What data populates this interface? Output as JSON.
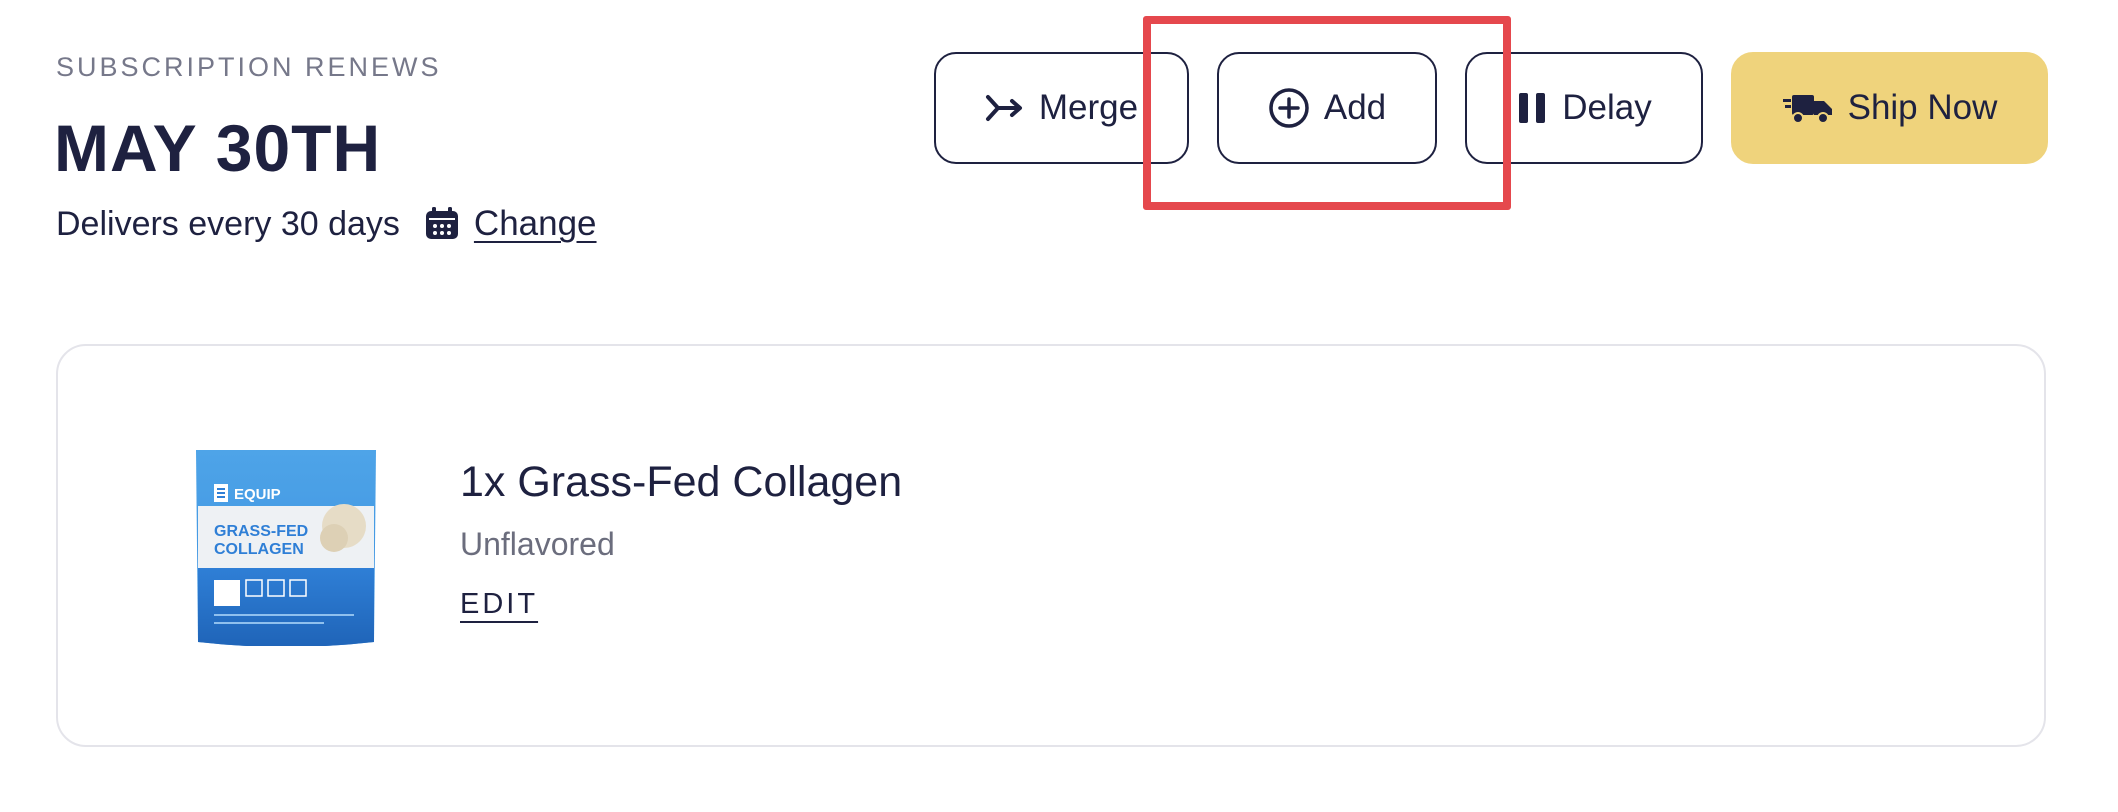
{
  "subscription": {
    "renews_label": "SUBSCRIPTION RENEWS",
    "renew_date": "MAY 30TH",
    "delivery_frequency": "Delivers every 30 days",
    "change_label": "Change"
  },
  "actions": {
    "merge_label": "Merge",
    "add_label": "Add",
    "delay_label": "Delay",
    "ship_now_label": "Ship Now"
  },
  "product": {
    "title": "1x Grass-Fed Collagen",
    "variant": "Unflavored",
    "edit_label": "EDIT",
    "package_brand": "EQUIP",
    "package_line1": "GRASS-FED",
    "package_line2": "COLLAGEN"
  },
  "colors": {
    "text_primary": "#1e2140",
    "text_muted": "#76788a",
    "ship_button_bg": "#efd37c",
    "highlight_border": "#e5484d",
    "card_border": "#e4e4ea",
    "package_blue": "#2f7fd6",
    "package_light_blue": "#4ea4e8"
  },
  "icons": {
    "merge": "merge-arrow-icon",
    "add": "plus-circle-icon",
    "delay": "pause-icon",
    "ship_now": "truck-icon",
    "calendar": "calendar-icon"
  }
}
